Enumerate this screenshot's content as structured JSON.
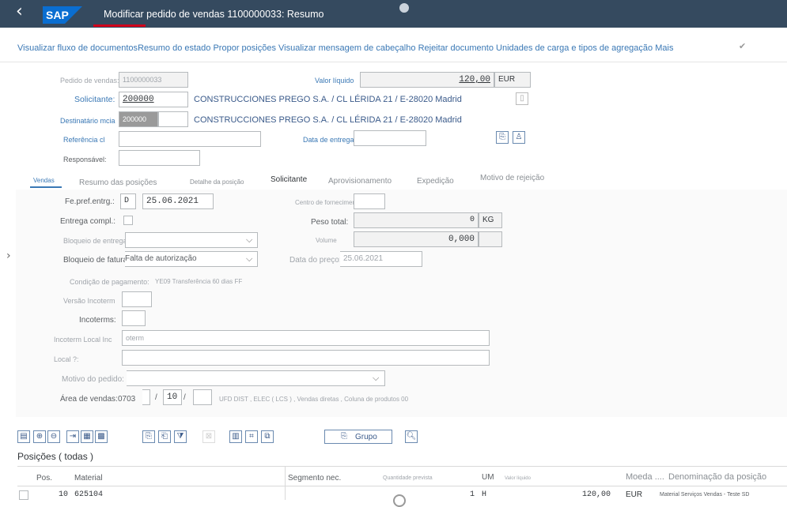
{
  "header": {
    "title": "Modificar pedido de vendas 1100000033: Resumo",
    "logo_text": "SAP",
    "back_glyph": "‹"
  },
  "toolbar": {
    "items": [
      "Visualizar fluxo de documentos",
      "Resumo do estado",
      "Propor posições",
      "Visualizar mensagem de cabeçalho",
      "Rejeitar documento",
      "Unidades de carga e tipos de agregação",
      "Mais"
    ],
    "check_glyph": "✔"
  },
  "header_fields": {
    "pedido_label": "Pedido de vendas:",
    "pedido_value": "1100000033",
    "valor_liquido_label": "Valor líquido",
    "valor_liquido_value": "120,00",
    "currency": "EUR",
    "solicitante_label": "Solicitante:",
    "solicitante_value": "200000",
    "solicitante_desc": "CONSTRUCCIONES PREGO S.A. / CL LÉRIDA 21 / E-28020 Madrid",
    "destinatario_label": "Destinatário mcia",
    "destinatario_value": "200000",
    "destinatario_desc": "CONSTRUCCIONES PREGO S.A. / CL LÉRIDA 21 / E-28020 Madrid",
    "referencia_label": "Referência cl",
    "data_entrega_label": "Data de entrega ao cliente",
    "responsavel_label": "Responsável:"
  },
  "tabs": [
    {
      "label": "Vendas"
    },
    {
      "label": "Resumo das posições"
    },
    {
      "label": "Detalhe da posição"
    },
    {
      "label": "Solicitante"
    },
    {
      "label": "Aprovisionamento"
    },
    {
      "label": "Expedição"
    },
    {
      "label": "Motivo de rejeição"
    }
  ],
  "vendas": {
    "fe_pref_label": "Fe.pref.entrg.:",
    "fe_pref_code": "D",
    "fe_pref_date": "25.06.2021",
    "centro_label": "Centro de fornecimento",
    "entrega_compl_label": "Entrega compl.:",
    "peso_label": "Peso total:",
    "peso_value": "0",
    "peso_unit": "KG",
    "bloqueio_entrega_label": "Bloqueio de entrega:",
    "volume_label": "Volume",
    "volume_value": "0,000",
    "bloqueio_fatura_label": "Bloqueio de fatura:",
    "bloqueio_fatura_value": "Falta de autorização",
    "data_preco_label": "Data do preço:",
    "data_preco_value": "25.06.2021",
    "condicao_label": "Condição de pagamento:",
    "condicao_value": "YE09 Transferência 60 dias FF",
    "versao_incoterm_label": "Versão Incoterm",
    "incoterms_label": "Incoterms:",
    "incoterm_local_label": "Incoterm Local Inc",
    "incoterm_local_placeholder": "oterm",
    "local_label": "Local ?:",
    "motivo_label": "Motivo do pedido:",
    "area_label": "Área de vendas:",
    "area_org": "0703",
    "area_sep1": "/",
    "area_canal": "10",
    "area_sep2": "/",
    "area_desc": "UFD DIST , ELEC ( LCS ) , Vendas diretas , Coluna de produtos 00"
  },
  "item_toolbar": {
    "grupo_label": "Grupo",
    "icons": [
      "details-icon",
      "add-row-icon",
      "remove-row-icon",
      "insert-icon",
      "grid-icon",
      "layout-icon",
      "doc-icon",
      "copy-icon",
      "filter-icon",
      "disabled-icon",
      "table-icon",
      "chart-icon",
      "export-icon"
    ]
  },
  "posicoes": {
    "title": "Posições ( todas )",
    "headers": {
      "pos": "Pos.",
      "material": "Material",
      "segmento": "Segmento nec.",
      "qtd_prevista": "Quantidade prevista",
      "um": "UM",
      "valor_liquido": "Valor líquido",
      "moeda": "Moeda ....",
      "denominacao": "Denominação da posição"
    },
    "rows": [
      {
        "pos": "10",
        "material": "625104",
        "qtd": "1",
        "um": "H",
        "valor": "120,00",
        "moeda": "EUR",
        "denominacao": "Material Serviços Vendas - Teste SD"
      }
    ]
  }
}
